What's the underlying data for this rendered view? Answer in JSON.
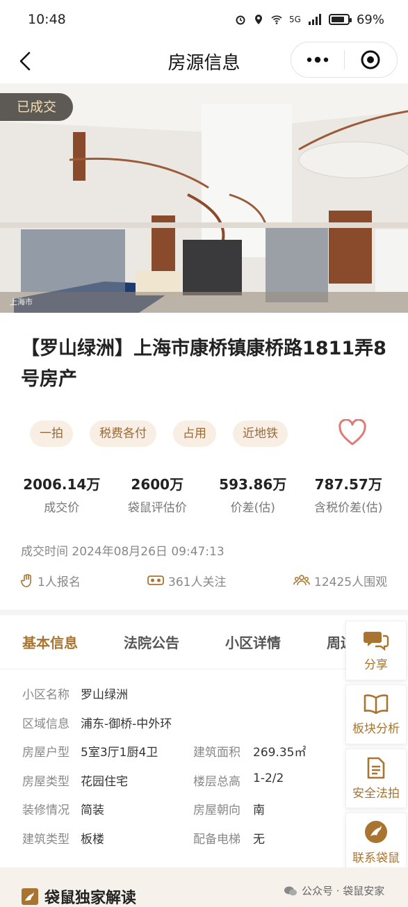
{
  "status_bar": {
    "time": "10:48",
    "battery": "69%",
    "network": "5G"
  },
  "nav": {
    "title": "房源信息"
  },
  "hero": {
    "badge": "已成交",
    "watermark": "上海市"
  },
  "property": {
    "title": "【罗山绿洲】上海市康桥镇康桥路1811弄8号房产"
  },
  "tags": [
    "一拍",
    "税费各付",
    "占用",
    "近地铁"
  ],
  "stats": [
    {
      "value": "2006.14万",
      "label": "成交价"
    },
    {
      "value": "2600万",
      "label": "袋鼠评估价"
    },
    {
      "value": "593.86万",
      "label": "价差(估)"
    },
    {
      "value": "787.57万",
      "label": "含税价差(估)"
    }
  ],
  "deal_time": "成交时间 2024年08月26日 09:47:13",
  "meta": {
    "signups": "1人报名",
    "followers": "361人关注",
    "viewers": "12425人围观"
  },
  "tabs": [
    "基本信息",
    "法院公告",
    "小区详情",
    "周边"
  ],
  "info": {
    "community_label": "小区名称",
    "community": "罗山绿洲",
    "region_label": "区域信息",
    "region": "浦东-御桥-中外环",
    "layout_label": "房屋户型",
    "layout": "5室3厅1厨4卫",
    "area_label": "建筑面积",
    "area": "269.35㎡",
    "type_label": "房屋类型",
    "type": "花园住宅",
    "floor_label": "楼层总高",
    "floor": "1-2/2",
    "decor_label": "装修情况",
    "decor": "简装",
    "orientation_label": "房屋朝向",
    "orientation": "南",
    "building_label": "建筑类型",
    "building": "板楼",
    "elevator_label": "配备电梯",
    "elevator": "无"
  },
  "side_actions": {
    "share": "分享",
    "analysis": "板块分析",
    "safe": "安全法拍",
    "contact": "联系袋鼠"
  },
  "bottom": {
    "exclusive": "袋鼠独家解读",
    "watermark": "公众号 · 袋鼠安家"
  },
  "colors": {
    "accent": "#a9742f",
    "tag_bg": "#f8eee3",
    "heart": "#e07a74"
  }
}
